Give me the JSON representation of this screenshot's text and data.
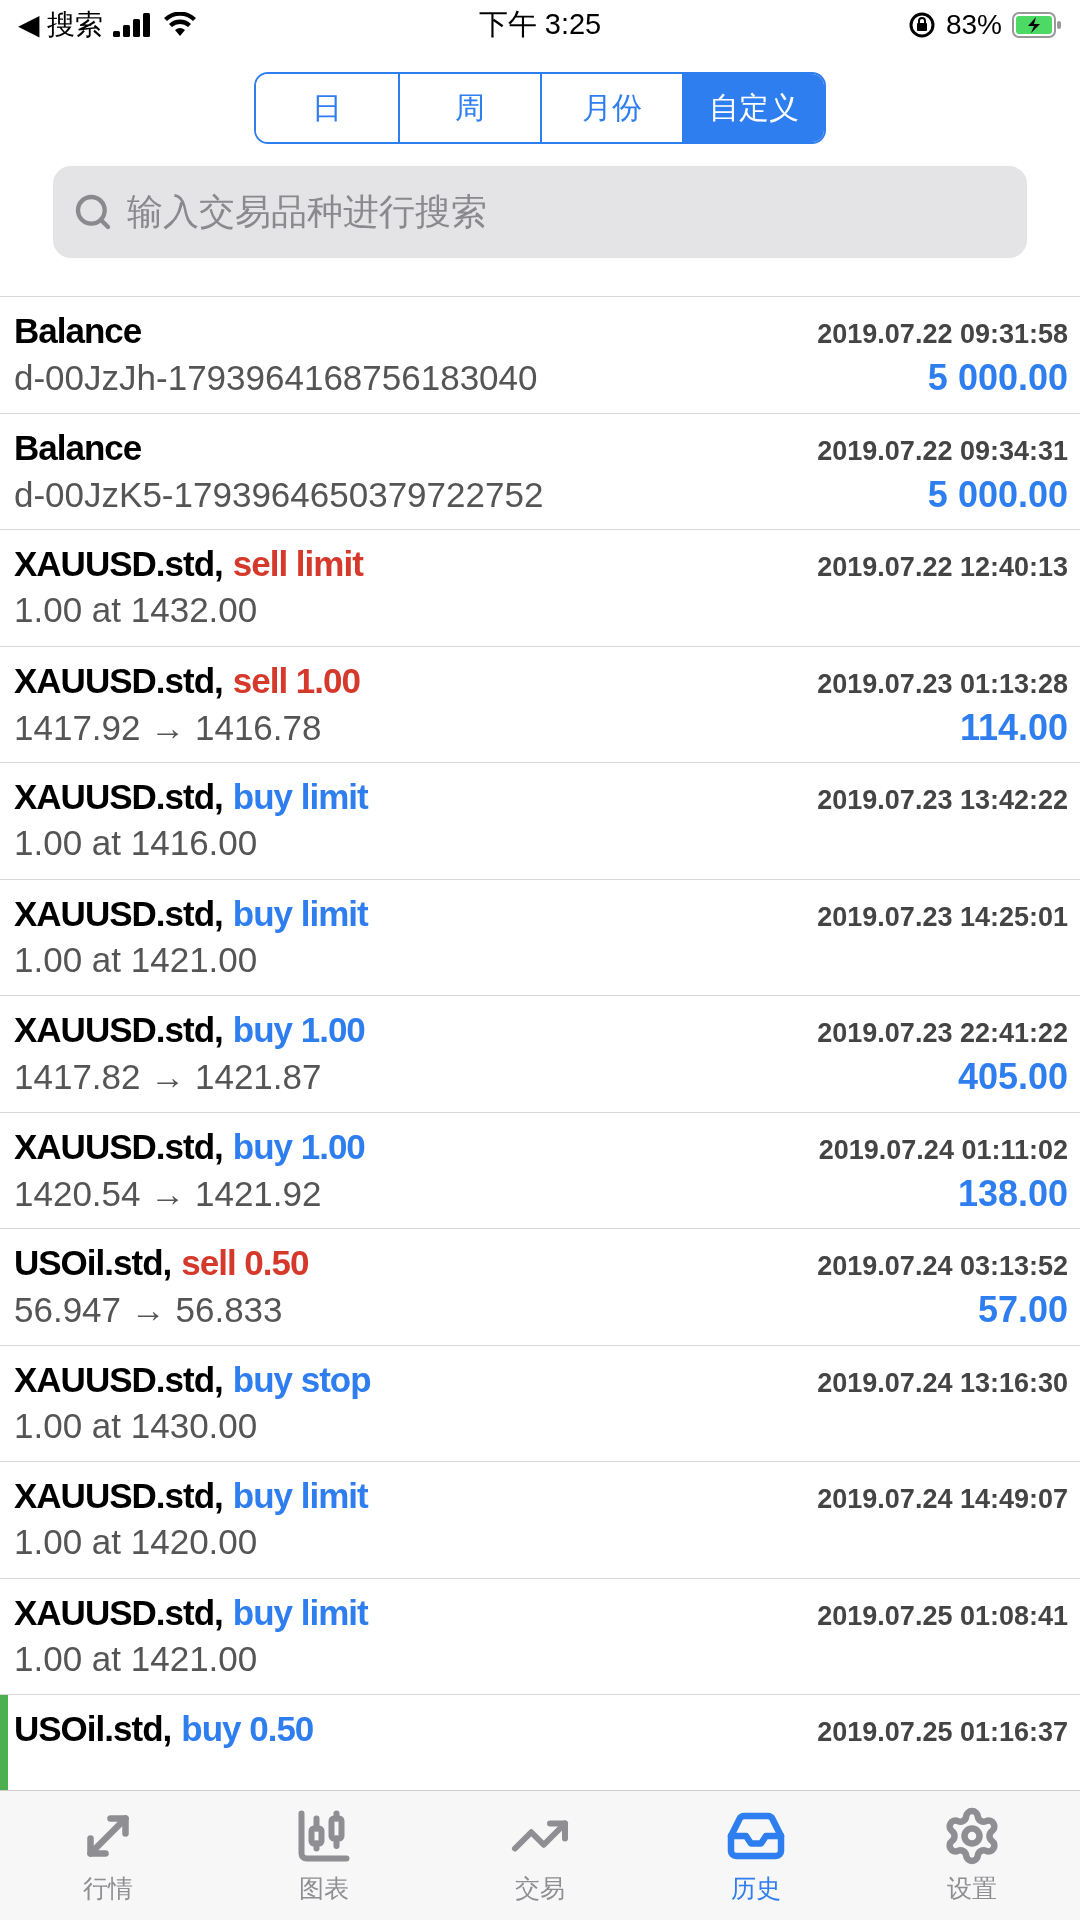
{
  "status_bar": {
    "back": "◀ 搜索",
    "time": "下午 3:25",
    "battery": "83%"
  },
  "segments": [
    {
      "label": "日",
      "selected": false
    },
    {
      "label": "周",
      "selected": false
    },
    {
      "label": "月份",
      "selected": false
    },
    {
      "label": "自定义",
      "selected": true
    }
  ],
  "search": {
    "placeholder": "输入交易品种进行搜索"
  },
  "rows": [
    {
      "kind": "balance",
      "title": "Balance",
      "time": "2019.07.22 09:31:58",
      "detail": "d-00JzJh-1793964168756183040",
      "amount": "5 000.00",
      "selected": false
    },
    {
      "kind": "balance",
      "title": "Balance",
      "time": "2019.07.22 09:34:31",
      "detail": "d-00JzK5-1793964650379722752",
      "amount": "5 000.00",
      "selected": false
    },
    {
      "kind": "order",
      "title": "XAUUSD.std,",
      "action": "sell limit",
      "color": "#d5392b",
      "time": "2019.07.22 12:40:13",
      "detail": "1.00 at 1432.00",
      "selected": false
    },
    {
      "kind": "deal",
      "title": "XAUUSD.std,",
      "action": "sell 1.00",
      "color": "#d5392b",
      "time": "2019.07.23 01:13:28",
      "detail": "1417.92 → 1416.78",
      "amount": "114.00",
      "selected": false
    },
    {
      "kind": "order",
      "title": "XAUUSD.std,",
      "action": "buy limit",
      "color": "#2f7ef0",
      "time": "2019.07.23 13:42:22",
      "detail": "1.00 at 1416.00",
      "selected": false
    },
    {
      "kind": "order",
      "title": "XAUUSD.std,",
      "action": "buy limit",
      "color": "#2f7ef0",
      "time": "2019.07.23 14:25:01",
      "detail": "1.00 at 1421.00",
      "selected": false
    },
    {
      "kind": "deal",
      "title": "XAUUSD.std,",
      "action": "buy 1.00",
      "color": "#2f7ef0",
      "time": "2019.07.23 22:41:22",
      "detail": "1417.82 → 1421.87",
      "amount": "405.00",
      "selected": false
    },
    {
      "kind": "deal",
      "title": "XAUUSD.std,",
      "action": "buy 1.00",
      "color": "#2f7ef0",
      "time": "2019.07.24 01:11:02",
      "detail": "1420.54 → 1421.92",
      "amount": "138.00",
      "selected": false
    },
    {
      "kind": "deal",
      "title": "USOil.std,",
      "action": "sell 0.50",
      "color": "#d5392b",
      "time": "2019.07.24 03:13:52",
      "detail": "56.947 → 56.833",
      "amount": "57.00",
      "selected": false
    },
    {
      "kind": "order",
      "title": "XAUUSD.std,",
      "action": "buy stop",
      "color": "#2f7ef0",
      "time": "2019.07.24 13:16:30",
      "detail": "1.00 at 1430.00",
      "selected": false
    },
    {
      "kind": "order",
      "title": "XAUUSD.std,",
      "action": "buy limit",
      "color": "#2f7ef0",
      "time": "2019.07.24 14:49:07",
      "detail": "1.00 at 1420.00",
      "selected": false
    },
    {
      "kind": "order",
      "title": "XAUUSD.std,",
      "action": "buy limit",
      "color": "#2f7ef0",
      "time": "2019.07.25 01:08:41",
      "detail": "1.00 at 1421.00",
      "selected": false
    },
    {
      "kind": "deal",
      "title": "USOil.std,",
      "action": "buy 0.50",
      "color": "#2f7ef0",
      "time": "2019.07.25 01:16:37",
      "selected": true
    }
  ],
  "tab_bar": [
    {
      "label": "行情",
      "selected": false
    },
    {
      "label": "图表",
      "selected": false
    },
    {
      "label": "交易",
      "selected": false
    },
    {
      "label": "历史",
      "selected": true
    },
    {
      "label": "设置",
      "selected": false
    }
  ]
}
